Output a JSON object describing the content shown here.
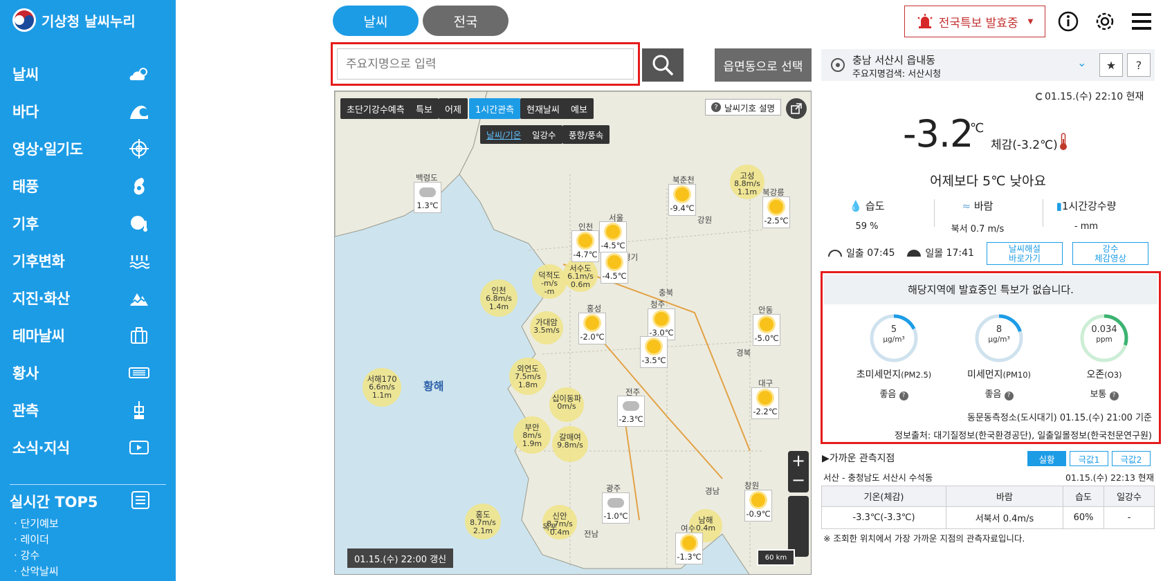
{
  "app": {
    "name": "기상청 날씨누리"
  },
  "sidebar": {
    "items": [
      {
        "label": "날씨",
        "icon": "partly-cloudy-icon"
      },
      {
        "label": "바다",
        "icon": "wave-icon"
      },
      {
        "label": "영상·일기도",
        "icon": "satellite-icon"
      },
      {
        "label": "태풍",
        "icon": "typhoon-icon"
      },
      {
        "label": "기후",
        "icon": "globe-thermometer-icon"
      },
      {
        "label": "기후변화",
        "icon": "flood-icon"
      },
      {
        "label": "지진·화산",
        "icon": "earthquake-icon"
      },
      {
        "label": "테마날씨",
        "icon": "suitcase-icon"
      },
      {
        "label": "황사",
        "icon": "dust-icon"
      },
      {
        "label": "관측",
        "icon": "observation-icon"
      },
      {
        "label": "소식·지식",
        "icon": "video-icon"
      }
    ],
    "top5": {
      "title": "실시간 TOP5",
      "items": [
        "· 단기예보",
        "· 레이더",
        "· 강수",
        "· 산악날씨"
      ]
    }
  },
  "tabs": {
    "weather": "날씨",
    "nation": "전국"
  },
  "search": {
    "placeholder": "주요지명으로 입력",
    "emd_button": "읍면동으로 선택"
  },
  "header": {
    "alert_label": "전국특보 발효중"
  },
  "map": {
    "buttons": [
      "초단기강수예측",
      "특보",
      "어제",
      "1시간관측",
      "현재날씨",
      "예보"
    ],
    "active_button": "1시간관측",
    "sub_buttons": [
      "날씨/기온",
      "일강수",
      "풍향/풍속"
    ],
    "legend_label": "날씨기호 설명",
    "sea_label": "황해",
    "refresh": "01.15.(수) 22:00 갱신",
    "scale": "60 km",
    "stations": [
      {
        "name": "백령도",
        "temp": "1.3℃",
        "icon": "partly-cloudy"
      },
      {
        "name": "북춘천",
        "temp": "-9.4℃",
        "icon": "sun"
      },
      {
        "name": "서울",
        "temp": "-4.5℃",
        "icon": "sun"
      },
      {
        "name": "인천",
        "temp": "-4.7℃",
        "icon": "sun"
      },
      {
        "name": "서수도",
        "temp": "-4.5℃",
        "icon": "sun"
      },
      {
        "name": "북강릉",
        "temp": "-2.5℃",
        "icon": "sun"
      },
      {
        "name": "홍성",
        "temp": "-2.0℃",
        "icon": "sun"
      },
      {
        "name": "청주",
        "temp": "-3.0℃",
        "icon": "sun"
      },
      {
        "name": "대전",
        "temp": "-3.5℃",
        "icon": "sun"
      },
      {
        "name": "안동",
        "temp": "-5.0℃",
        "icon": "sun"
      },
      {
        "name": "전주",
        "temp": "-2.3℃",
        "icon": "cloud"
      },
      {
        "name": "대구",
        "temp": "-2.2℃",
        "icon": "sun"
      },
      {
        "name": "광주",
        "temp": "-1.0℃",
        "icon": "cloud"
      },
      {
        "name": "창원",
        "temp": "-0.9℃",
        "icon": "sun"
      },
      {
        "name": "여수",
        "temp": "-1.3℃",
        "icon": "sun"
      },
      {
        "name": "목포",
        "temp": "",
        "icon": "cloud"
      }
    ],
    "buoys": [
      {
        "name": "고성",
        "wind": "8.8m/s",
        "wave": "1.1m"
      },
      {
        "name": "인천",
        "wind": "6.8m/s",
        "wave": "1.4m"
      },
      {
        "name": "덕적도",
        "wind": "-m/s",
        "wave": "-m"
      },
      {
        "name": "서수도",
        "wind": "6.1m/s",
        "wave": "0.6m"
      },
      {
        "name": "가대암",
        "wind": "3.5m/s",
        "wave": ""
      },
      {
        "name": "서해170",
        "wind": "6.6m/s",
        "wave": "1.1m"
      },
      {
        "name": "외연도",
        "wind": "7.5m/s",
        "wave": "1.8m"
      },
      {
        "name": "십이동파",
        "wind": "0m/s",
        "wave": ""
      },
      {
        "name": "부안",
        "wind": "8m/s",
        "wave": "1.9m"
      },
      {
        "name": "갈매여",
        "wind": "9.8m/s",
        "wave": ""
      },
      {
        "name": "홍도",
        "wind": "8.7m/s",
        "wave": "2.1m"
      },
      {
        "name": "신안",
        "wind": "8.7m/s",
        "wave": "0.4m"
      },
      {
        "name": "남해",
        "wind": "",
        "wave": "0.4m"
      }
    ],
    "places": [
      "강원",
      "경기",
      "충북",
      "경북",
      "전남",
      "경남"
    ]
  },
  "location": {
    "name": "충남 서산시 읍내동",
    "sub": "주요지명검색: 서산시청"
  },
  "current": {
    "obs_time": "01.15.(수) 22:10 현재",
    "temp": "-3.2",
    "temp_unit": "℃",
    "feel": "체감(-3.2℃)",
    "compare": "어제보다 5℃ 낮아요",
    "humidity_label": "습도",
    "humidity": "59 %",
    "wind_label": "바람",
    "wind": "북서 0.7 m/s",
    "rain_label": "1시간강수량",
    "rain": "- mm",
    "sunrise_label": "일출",
    "sunrise": "07:45",
    "sunset_label": "일몰",
    "sunset": "17:41",
    "btn_commentary": "날씨해설\n바로가기",
    "btn_video": "강수\n체감영상"
  },
  "warnings": {
    "message": "해당지역에 발효중인 특보가 없습니다.",
    "aq": [
      {
        "name": "초미세먼지",
        "sub": "(PM2.5)",
        "value": "5",
        "unit": "μg/m³",
        "grade": "좋음",
        "fraction": 0.18,
        "color": "#1d9ce6"
      },
      {
        "name": "미세먼지",
        "sub": "(PM10)",
        "value": "8",
        "unit": "μg/m³",
        "grade": "좋음",
        "fraction": 0.2,
        "color": "#1d9ce6"
      },
      {
        "name": "오존",
        "sub": "(O3)",
        "value": "0.034",
        "unit": "ppm",
        "grade": "보통",
        "fraction": 0.3,
        "color": "#3cb371"
      }
    ],
    "station": "동문동측정소(도시대기) 01.15.(수) 21:00 기준",
    "source": "정보출처: 대기질정보(한국환경공단), 일출일몰정보(한국천문연구원)"
  },
  "nearby": {
    "title": "▶가까운 관측지점",
    "tabs": [
      "실황",
      "극값1",
      "극값2"
    ],
    "location": "서산 - 충청남도 서산시 수석동",
    "time": "01.15.(수) 22:13 현재",
    "headers": [
      "기온(체감)",
      "바람",
      "습도",
      "일강수"
    ],
    "row": [
      "-3.3℃(-3.3℃)",
      "서북서 0.4m/s",
      "60%",
      "-"
    ],
    "note": "※ 조회한 위치에서 가장 가까운 지점의 관측자료입니다."
  }
}
